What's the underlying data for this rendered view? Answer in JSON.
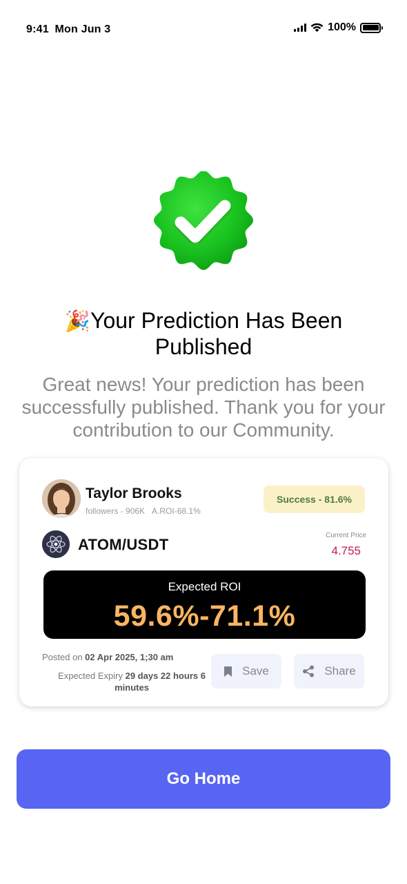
{
  "status_bar": {
    "time": "9:41",
    "date": "Mon Jun 3",
    "battery": "100%"
  },
  "success_icon": "verified-check-badge-icon",
  "title": {
    "emoji": "🎉",
    "text": "Your Prediction Has Been Published"
  },
  "subtitle": "Great news! Your prediction has been successfully published. Thank you for your contribution to our Community.",
  "card": {
    "user": {
      "name": "Taylor Brooks",
      "followers": "followers - 906K",
      "aroi": "A.ROI-68.1%"
    },
    "success_badge": "Success - 81.6%",
    "pair": "ATOM/USDT",
    "current_price_label": "Current Price",
    "current_price": "4.755",
    "roi_label": "Expected ROI",
    "roi_value": "59.6%-71.1%",
    "posted_label": "Posted on",
    "posted_value": "02 Apr 2025, 1;30 am",
    "expiry_label": "Expected Expiry",
    "expiry_value": "29 days 22 hours 6 minutes",
    "save_label": "Save",
    "share_label": "Share"
  },
  "go_home_label": "Go Home",
  "colors": {
    "primary_button": "#5865f2",
    "success_green": "#22c02a",
    "roi_orange": "#f8b563",
    "price_pink": "#c2185b",
    "success_badge_bg": "#fbf1c9"
  }
}
